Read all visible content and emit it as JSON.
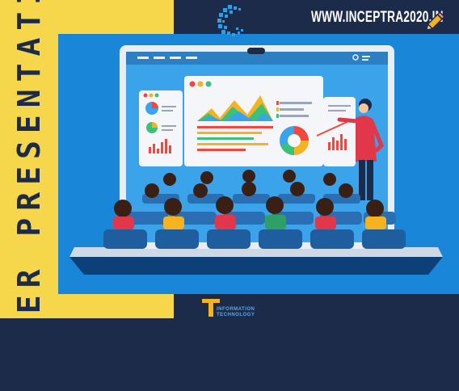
{
  "sidebar": {
    "title": "PAPER PRESENTATION"
  },
  "header": {
    "url": "WWW.INCEPTRA2020.IN",
    "edit_icon": "pencil-icon",
    "brand_icon": "pixel-c-logo-icon"
  },
  "footer": {
    "logo_line1": "INFORMATION",
    "logo_line2": "TECHNOLOGY"
  },
  "colors": {
    "yellow": "#f6d64a",
    "navy": "#1c2b4a",
    "blue": "#1a86d8",
    "orange": "#f6b21f"
  }
}
